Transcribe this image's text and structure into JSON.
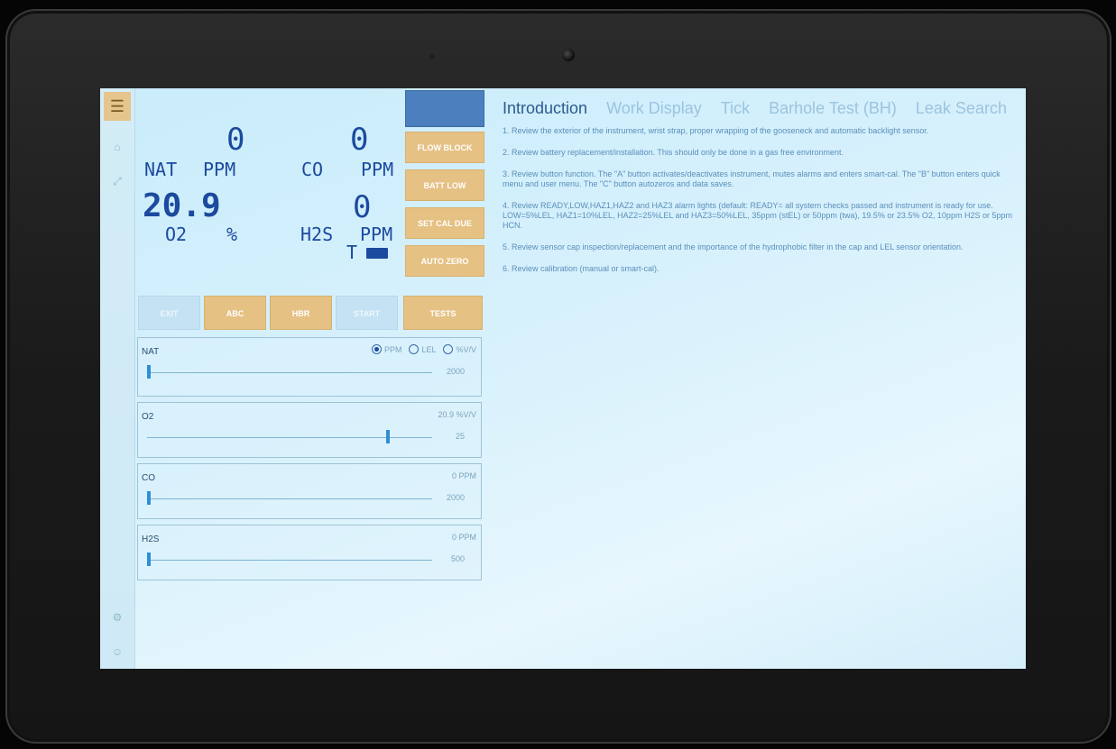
{
  "display": {
    "nat": {
      "label": "NAT",
      "unit": "PPM",
      "value": "0"
    },
    "co": {
      "label": "CO",
      "unit": "PPM",
      "value": "0"
    },
    "o2": {
      "label": "O2",
      "unit": "%",
      "value": "20.9"
    },
    "h2s": {
      "label": "H2S",
      "unit": "PPM",
      "value": "0"
    },
    "temp_label": "T"
  },
  "side_buttons": [
    "FLOW BLOCK",
    "BATT LOW",
    "SET CAL DUE",
    "AUTO ZERO"
  ],
  "mode_buttons": [
    "EXIT",
    "ABC",
    "HBR",
    "START",
    "TESTS"
  ],
  "gas_controls": [
    {
      "name": "NAT",
      "unit": "",
      "max": "2000",
      "level": 0.0,
      "options": [
        {
          "label": "PPM",
          "selected": true
        },
        {
          "label": "LEL",
          "selected": false
        },
        {
          "label": "%V/V",
          "selected": false
        }
      ]
    },
    {
      "name": "O2",
      "unit": "20.9 %V/V",
      "max": "25",
      "level": 0.84
    },
    {
      "name": "CO",
      "unit": "0 PPM",
      "max": "2000",
      "level": 0.0
    },
    {
      "name": "H2S",
      "unit": "0 PPM",
      "max": "500",
      "level": 0.0
    }
  ],
  "tabs": [
    "Introduction",
    "Work Display",
    "Tick",
    "Barhole Test (BH)",
    "Leak Search"
  ],
  "active_tab": "Introduction",
  "steps": [
    "1. Review the exterior of the instrument, wrist strap, proper wrapping of the gooseneck and automatic backlight sensor.",
    "2. Review battery replacement/installation. This should only be done in a gas free environment.",
    "3. Review button function. The \"A\" button activates/deactivates instrument, mutes alarms and enters smart-cal. The \"B\" button enters quick menu and user menu. The \"C\" button autozeros and data saves.",
    "4. Review READY,LOW,HAZ1,HAZ2 and HAZ3 alarm lights (default: READY= all system checks passed and instrument is ready for use. LOW=5%LEL, HAZ1=10%LEL, HAZ2=25%LEL and HAZ3=50%LEL, 35ppm (stEL) or 50ppm (twa), 19.5% or 23.5% O2, 10ppm H2S or 5ppm HCN.",
    "5. Review sensor cap inspection/replacement and the importance of the hydrophobic filter in the cap and LEL sensor orientation.",
    "6. Review calibration (manual or smart-cal)."
  ],
  "colors": {
    "accent": "#e6c184",
    "display": "#1b4a9e",
    "screen": "#d3eefb"
  }
}
